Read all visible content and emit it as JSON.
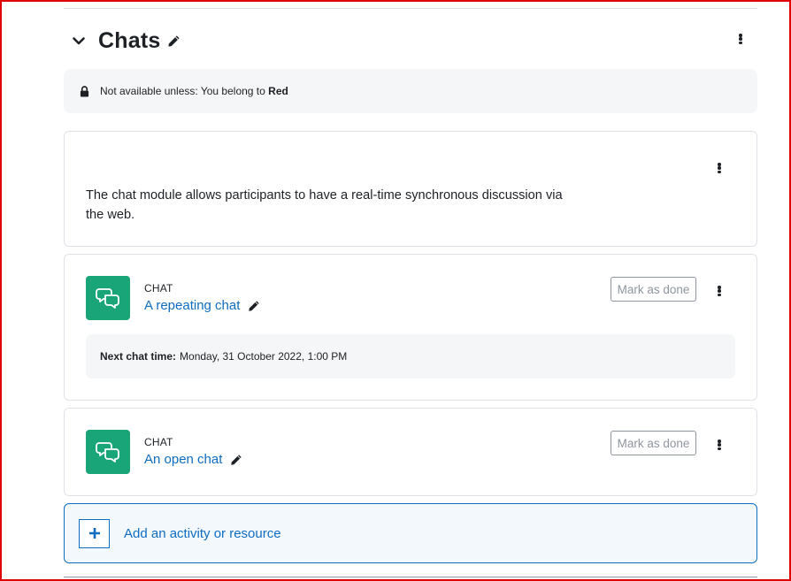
{
  "section": {
    "title": "Chats",
    "restriction": {
      "prefix": "Not available unless: You belong to",
      "group": "Red"
    },
    "summary": "The chat module allows participants to have a real-time synchronous discussion via the web."
  },
  "activities": [
    {
      "type": "CHAT",
      "name": "A repeating chat",
      "mark_label": "Mark as done",
      "date_label": "Next chat time:",
      "date_value": "Monday, 31 October 2022, 1:00 PM"
    },
    {
      "type": "CHAT",
      "name": "An open chat",
      "mark_label": "Mark as done"
    }
  ],
  "add_activity": {
    "label": "Add an activity or resource"
  },
  "icons": {
    "collapse": "chevron-down-icon",
    "edit": "pencil-icon",
    "menu": "kebab-menu-icon",
    "lock": "lock-icon",
    "chat": "chat-bubbles-icon",
    "add": "plus-icon"
  },
  "colors": {
    "chat_icon_bg": "#1aa579",
    "link": "#0f6cbf",
    "restriction_bg": "#f5f6f7"
  }
}
